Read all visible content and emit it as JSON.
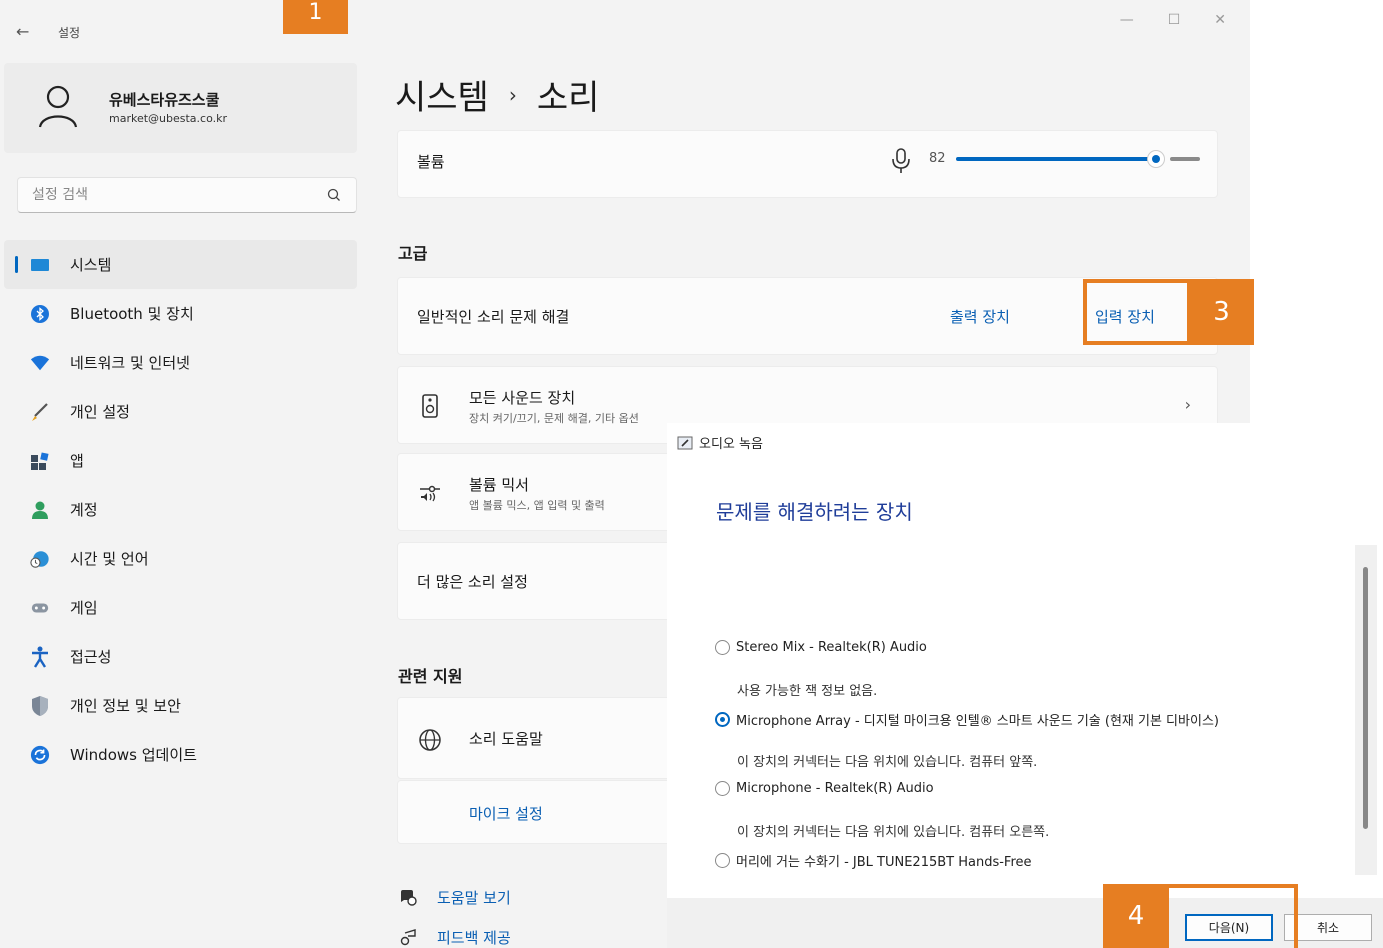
{
  "window": {
    "back_glyph": "←",
    "title": "설정",
    "controls": {
      "minimize": "—",
      "maximize": "☐",
      "close": "✕"
    }
  },
  "profile": {
    "name": "유베스타유즈스쿨",
    "email": "market@ubesta.co.kr"
  },
  "search": {
    "placeholder": "설정 검색"
  },
  "sidebar": {
    "items": [
      {
        "label": "시스템",
        "icon": "system-icon",
        "active": true
      },
      {
        "label": "Bluetooth 및 장치",
        "icon": "bluetooth-icon"
      },
      {
        "label": "네트워크 및 인터넷",
        "icon": "wifi-icon"
      },
      {
        "label": "개인 설정",
        "icon": "brush-icon"
      },
      {
        "label": "앱",
        "icon": "apps-icon"
      },
      {
        "label": "계정",
        "icon": "account-icon"
      },
      {
        "label": "시간 및 언어",
        "icon": "globe-clock-icon"
      },
      {
        "label": "게임",
        "icon": "gamepad-icon"
      },
      {
        "label": "접근성",
        "icon": "accessibility-icon"
      },
      {
        "label": "개인 정보 및 보안",
        "icon": "shield-icon"
      },
      {
        "label": "Windows 업데이트",
        "icon": "update-icon"
      }
    ]
  },
  "main": {
    "breadcrumb": {
      "parent": "시스템",
      "separator": "›",
      "current": "소리"
    },
    "volume": {
      "label": "볼륨",
      "value": "82",
      "level": 0.82
    },
    "advanced_heading": "고급",
    "troubleshoot": {
      "label": "일반적인 소리 문제 해결",
      "output_link": "출력 장치",
      "input_link": "입력 장치"
    },
    "all_devices": {
      "title": "모든 사운드 장치",
      "subtitle": "장치 켜기/끄기, 문제 해결, 기타 옵션",
      "chevron": "›"
    },
    "mixer": {
      "title": "볼륨 믹서",
      "subtitle": "앱 볼륨 믹스, 앱 입력 및 출력"
    },
    "more_settings": "더 많은 소리 설정",
    "related_heading": "관련 지원",
    "sound_help": "소리 도움말",
    "mic_setup": "마이크 설정",
    "get_help": "도움말 보기",
    "feedback": "피드백 제공"
  },
  "markers": {
    "one": "1",
    "three": "3",
    "four": "4"
  },
  "dialog": {
    "title": "오디오 녹음",
    "heading": "문제를 해결하려는 장치",
    "devices": [
      {
        "label": "Stereo Mix - Realtek(R) Audio",
        "info": "사용 가능한 잭 정보 없음.",
        "checked": false
      },
      {
        "label": "Microphone Array - 디지털 마이크용 인텔® 스마트 사운드 기술 (현재 기본 디바이스)",
        "info": "이 장치의 커넥터는 다음 위치에 있습니다. 컴퓨터 앞쪽.",
        "checked": true
      },
      {
        "label": "Microphone - Realtek(R) Audio",
        "info": "이 장치의 커넥터는 다음 위치에 있습니다. 컴퓨터 오른쪽.",
        "checked": false
      },
      {
        "label": "머리에 거는 수화기 - JBL TUNE215BT Hands-Free",
        "checked": false
      }
    ],
    "next_button": "다음(N)",
    "cancel_button": "취소"
  },
  "colors": {
    "accent": "#0067c0",
    "marker": "#e67e22",
    "link": "#0a5fb3"
  }
}
